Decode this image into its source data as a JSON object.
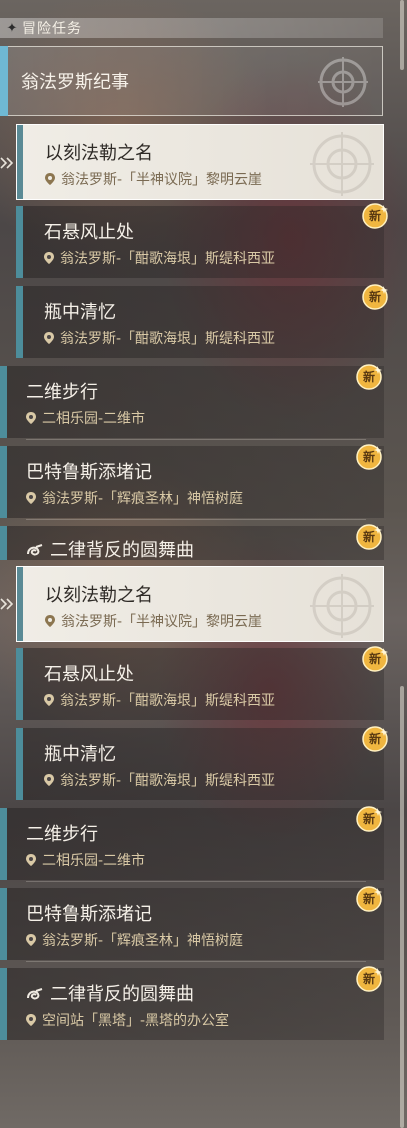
{
  "header": {
    "title": "冒险任务"
  },
  "category": {
    "name": "翁法罗斯纪事"
  },
  "badge_label": "新",
  "quests_top": [
    {
      "name": "以刻法勒之名",
      "location": "翁法罗斯-「半神议院」黎明云崖"
    },
    {
      "name": "石悬风止处",
      "location": "翁法罗斯-「酣歌海垠」斯缇科西亚"
    },
    {
      "name": "瓶中清忆",
      "location": "翁法罗斯-「酣歌海垠」斯缇科西亚"
    },
    {
      "name": "二维步行",
      "location": "二相乐园-二维市"
    },
    {
      "name": "巴特鲁斯添堵记",
      "location": "翁法罗斯-「辉痕圣林」神悟树庭"
    },
    {
      "name": "二律背反的圆舞曲"
    }
  ],
  "quests_bottom": [
    {
      "name": "以刻法勒之名",
      "location": "翁法罗斯-「半神议院」黎明云崖"
    },
    {
      "name": "石悬风止处",
      "location": "翁法罗斯-「酣歌海垠」斯缇科西亚"
    },
    {
      "name": "瓶中清忆",
      "location": "翁法罗斯-「酣歌海垠」斯缇科西亚"
    },
    {
      "name": "二维步行",
      "location": "二相乐园-二维市"
    },
    {
      "name": "巴特鲁斯添堵记",
      "location": "翁法罗斯-「辉痕圣林」神悟树庭"
    },
    {
      "name": "二律背反的圆舞曲",
      "location": "空间站「黑塔」-黑塔的办公室"
    }
  ],
  "colors": {
    "accent_bar": "#4d8d9b",
    "category_bar": "#6fb8d3",
    "badge": "#f0b640",
    "location_text": "#d9c9a6"
  },
  "icons": {
    "header": "diamond-star-icon",
    "pin": "map-pin-icon",
    "badge": "new-badge-icon",
    "selected": "double-chevron-right-icon"
  }
}
